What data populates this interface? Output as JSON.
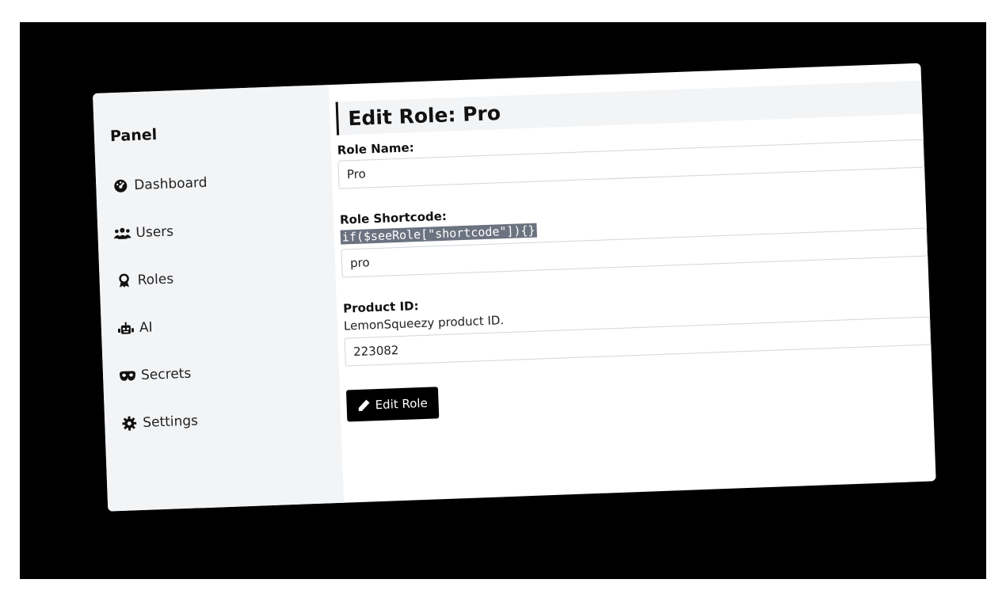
{
  "sidebar": {
    "title": "Panel",
    "items": [
      {
        "label": "Dashboard",
        "icon": "dashboard-gauge-icon"
      },
      {
        "label": "Users",
        "icon": "users-icon"
      },
      {
        "label": "Roles",
        "icon": "award-icon"
      },
      {
        "label": "AI",
        "icon": "robot-icon"
      },
      {
        "label": "Secrets",
        "icon": "mask-icon"
      },
      {
        "label": "Settings",
        "icon": "gear-icon"
      }
    ]
  },
  "main": {
    "title": "Edit Role: Pro",
    "role_name": {
      "label": "Role Name:",
      "value": "Pro"
    },
    "role_shortcode": {
      "label": "Role Shortcode:",
      "help_code": "if($seeRole[\"shortcode\"]){}",
      "value": "pro"
    },
    "product_id": {
      "label": "Product ID:",
      "help": "LemonSqueezy product ID.",
      "value": "223082"
    },
    "submit_label": "Edit Role"
  },
  "colors": {
    "background": "#000000",
    "sidebar_bg": "#f3f4f6",
    "button_bg": "#000000",
    "code_highlight": "#6b7280"
  }
}
